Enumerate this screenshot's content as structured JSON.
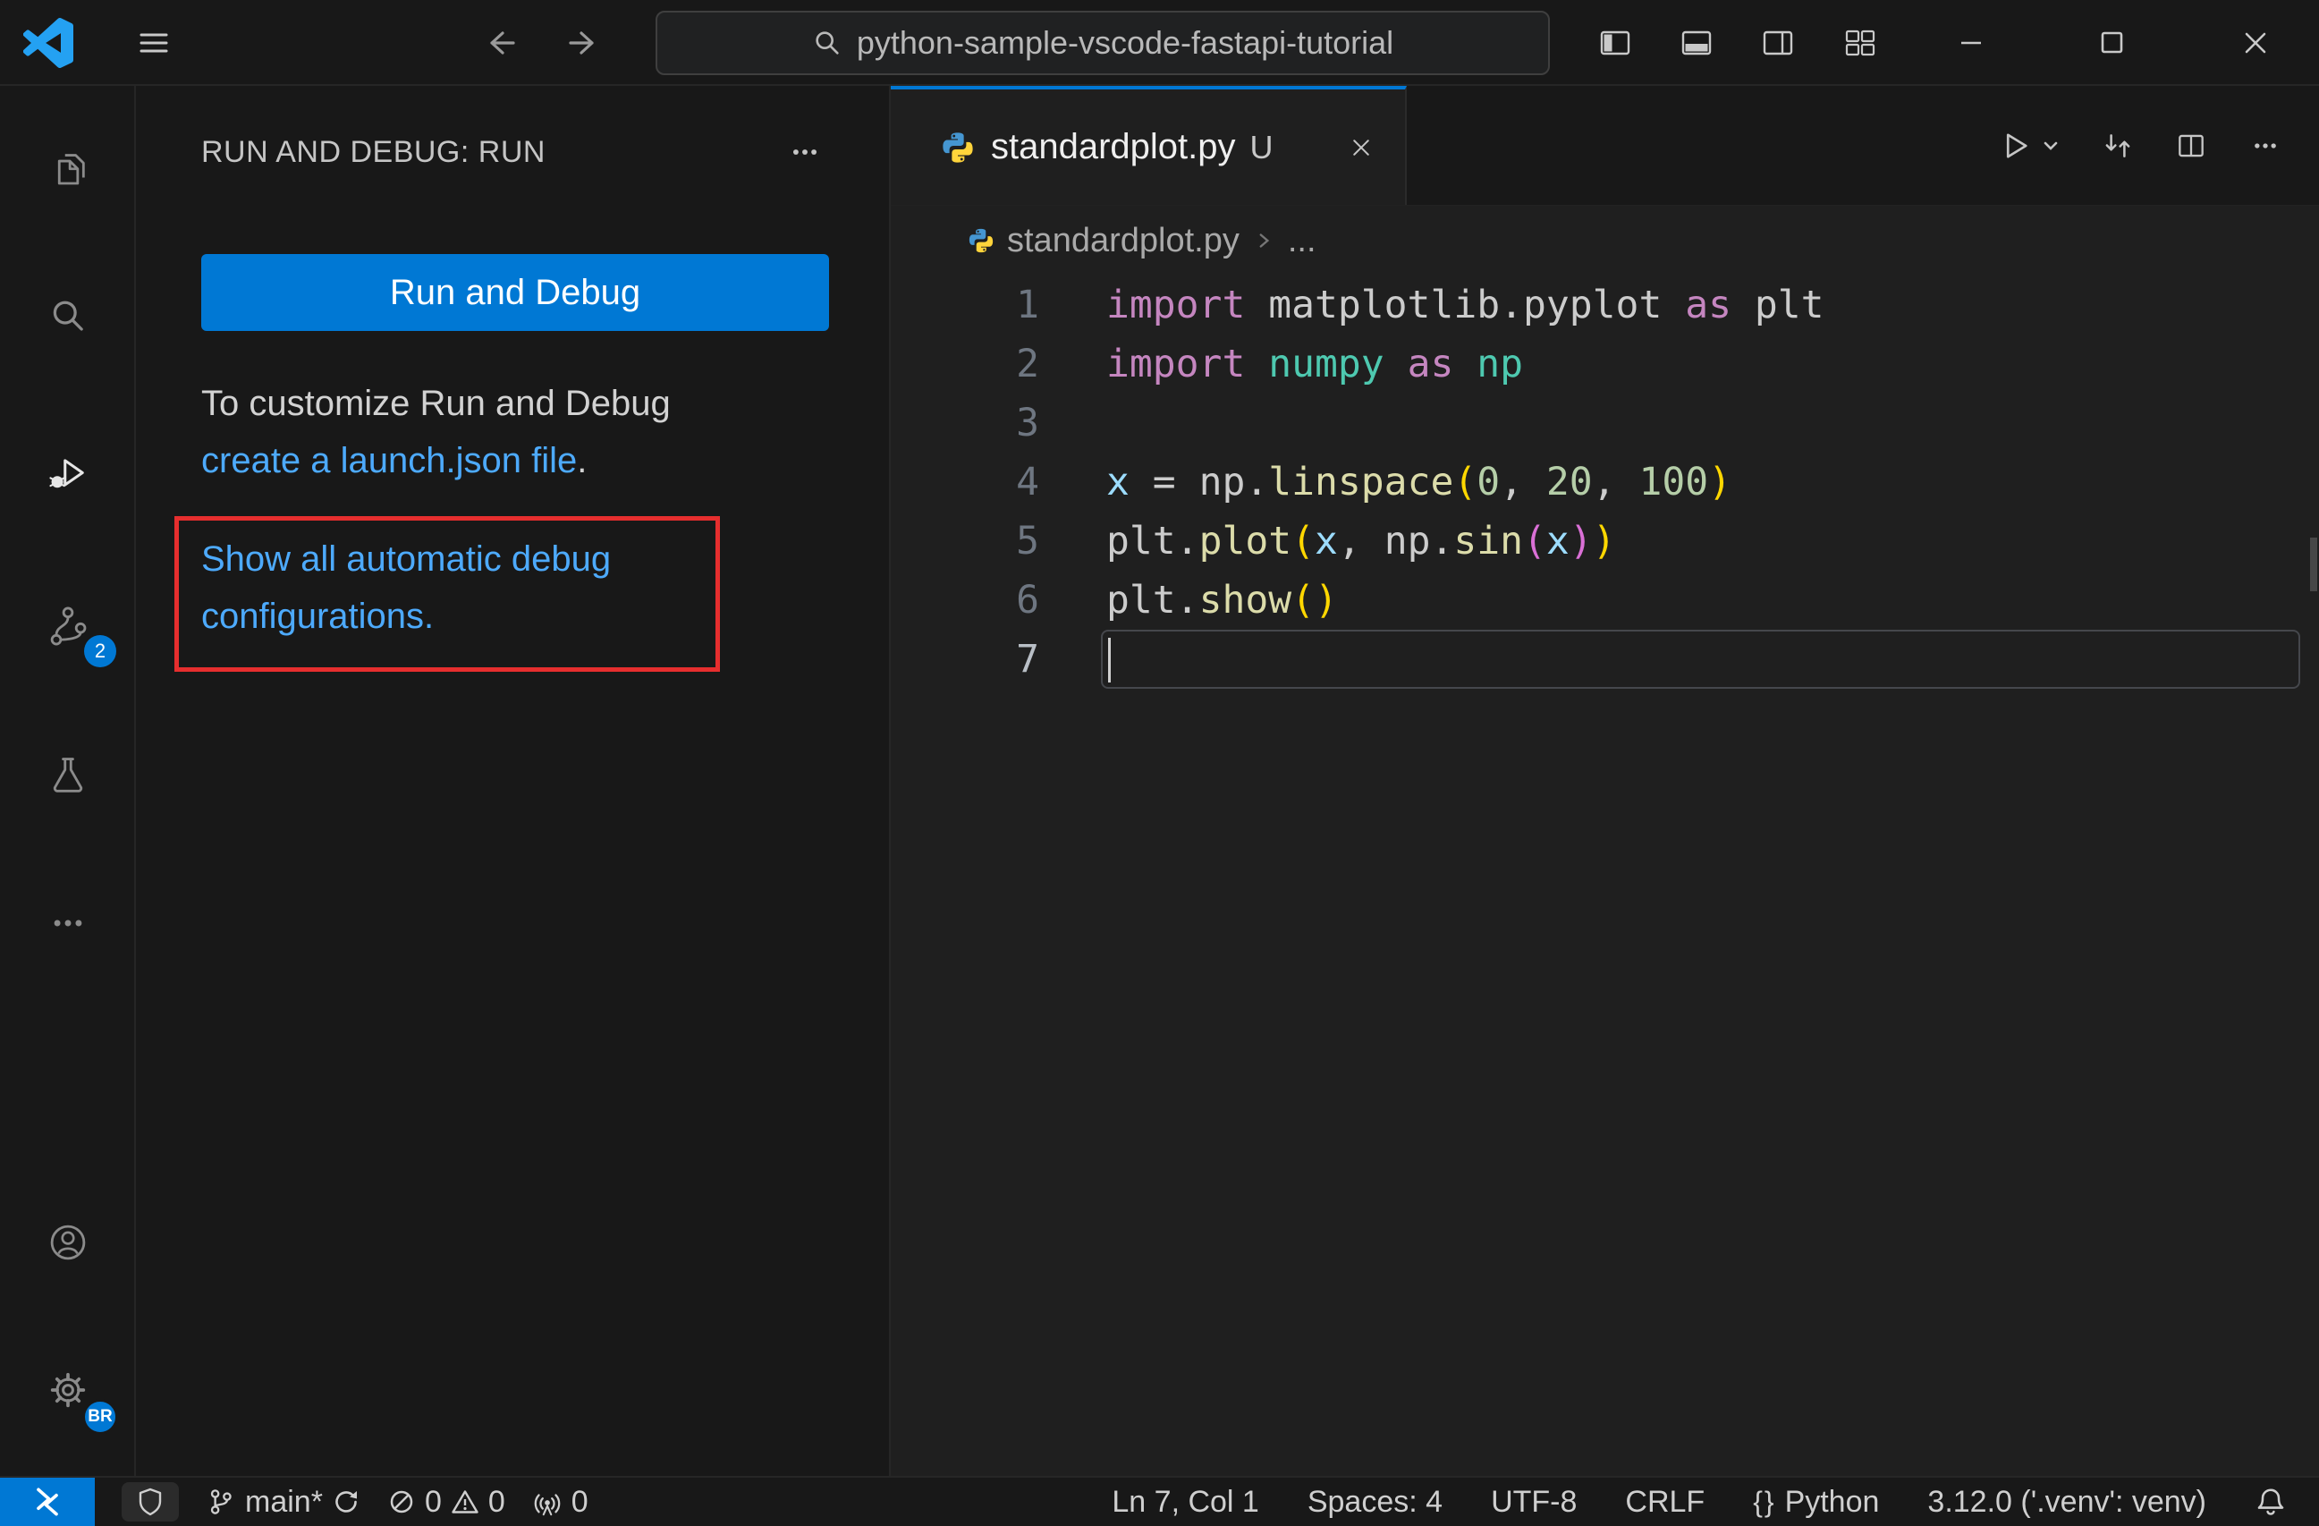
{
  "colors": {
    "shell_bg": "#181818",
    "editor_bg": "#1f1f1f",
    "accent_blue": "#0078d4",
    "link_blue": "#4daafc",
    "annotation_red": "#e62e2e"
  },
  "window": {
    "search_text": "python-sample-vscode-fastapi-tutorial"
  },
  "activity_bar": {
    "source_control_badge": "2",
    "profile_badge": "BR"
  },
  "sidebar": {
    "header": "RUN AND DEBUG: RUN",
    "run_button_label": "Run and Debug",
    "customize_text": "To customize Run and Debug",
    "launch_link_text": "create a launch.json file",
    "launch_suffix": ".",
    "auto_config_link": "Show all automatic debug configurations."
  },
  "editor": {
    "tab": {
      "filename": "standardplot.py",
      "git_badge": "U"
    },
    "breadcrumb": {
      "filename": "standardplot.py",
      "symbol_ellipsis": "..."
    },
    "code_lines": [
      {
        "num": "1",
        "segments": [
          [
            "kw",
            "import"
          ],
          [
            "txt",
            " matplotlib.pyplot "
          ],
          [
            "kw",
            "as"
          ],
          [
            "txt",
            " plt"
          ]
        ]
      },
      {
        "num": "2",
        "segments": [
          [
            "kw",
            "import"
          ],
          [
            "txt",
            " "
          ],
          [
            "mod",
            "numpy"
          ],
          [
            "txt",
            " "
          ],
          [
            "kw",
            "as"
          ],
          [
            "txt",
            " "
          ],
          [
            "mod",
            "np"
          ]
        ]
      },
      {
        "num": "3",
        "segments": []
      },
      {
        "num": "4",
        "segments": [
          [
            "var",
            "x"
          ],
          [
            "txt",
            " = "
          ],
          [
            "txt",
            "np."
          ],
          [
            "fn",
            "linspace"
          ],
          [
            "b1",
            "("
          ],
          [
            "num",
            "0"
          ],
          [
            "txt",
            ", "
          ],
          [
            "num",
            "20"
          ],
          [
            "txt",
            ", "
          ],
          [
            "num",
            "100"
          ],
          [
            "b1",
            ")"
          ]
        ]
      },
      {
        "num": "5",
        "segments": [
          [
            "txt",
            "plt."
          ],
          [
            "fn",
            "plot"
          ],
          [
            "b1",
            "("
          ],
          [
            "var",
            "x"
          ],
          [
            "txt",
            ", "
          ],
          [
            "txt",
            "np."
          ],
          [
            "fn",
            "sin"
          ],
          [
            "b2",
            "("
          ],
          [
            "var",
            "x"
          ],
          [
            "b2",
            ")"
          ],
          [
            "b1",
            ")"
          ]
        ]
      },
      {
        "num": "6",
        "segments": [
          [
            "txt",
            "plt."
          ],
          [
            "fn",
            "show"
          ],
          [
            "b1",
            "("
          ],
          [
            "b1",
            ")"
          ]
        ]
      },
      {
        "num": "7",
        "segments": [],
        "current": true,
        "cursor": true
      }
    ]
  },
  "statusbar": {
    "branch": "main*",
    "errors": "0",
    "warnings": "0",
    "ports": "0",
    "cursor_position": "Ln 7, Col 1",
    "indentation": "Spaces: 4",
    "encoding": "UTF-8",
    "eol": "CRLF",
    "language_icon": "{}",
    "language": "Python",
    "interpreter": "3.12.0 ('.venv': venv)"
  }
}
